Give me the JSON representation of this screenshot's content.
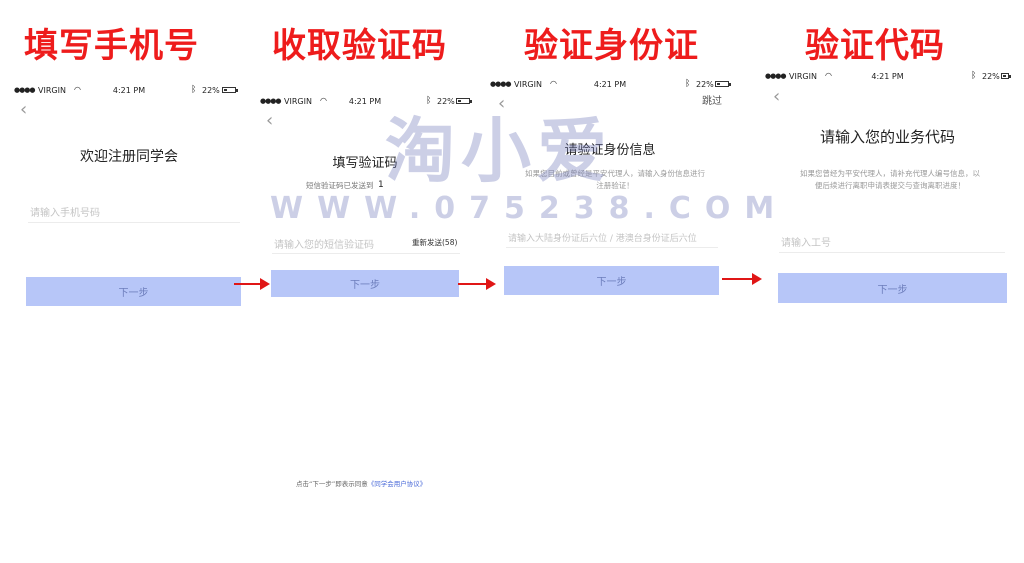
{
  "steps": [
    {
      "title": "填写手机号"
    },
    {
      "title": "收取验证码"
    },
    {
      "title": "验证身份证"
    },
    {
      "title": "验证代码"
    }
  ],
  "status_bar": {
    "signal": "●●●●",
    "carrier": "VIRGIN",
    "wifi": "wifi-icon",
    "time": "4:21 PM",
    "bluetooth": "bluetooth-icon",
    "battery": "22%"
  },
  "screen1": {
    "heading": "欢迎注册同学会",
    "phone_placeholder": "请输入手机号码",
    "next_label": "下一步"
  },
  "screen2": {
    "heading": "填写验证码",
    "sent_note": "短信验证码已发送到",
    "sent_digit": "1",
    "code_placeholder": "请输入您的短信验证码",
    "resend": "重新发送(58)",
    "next_label": "下一步",
    "agreement_prefix": "点击“下一步”即表示同意",
    "agreement_link": "《同学会用户协议》"
  },
  "screen3": {
    "skip": "跳过",
    "heading": "请验证身份信息",
    "desc_line1": "如果您目前或曾经是平安代理人，请输入身份信息进行",
    "desc_line2": "注册验证！",
    "id_placeholder": "请输入大陆身份证后六位 / 港澳台身份证后六位",
    "next_label": "下一步"
  },
  "screen4": {
    "heading": "请输入您的业务代码",
    "desc_line1": "如果您曾经为平安代理人，请补充代理人编号信息，以",
    "desc_line2": "便后续进行离职申请表提交与查询离职进度！",
    "employee_placeholder": "请输入工号",
    "next_label": "下一步"
  },
  "watermark": {
    "logo": "淘小爱",
    "url": "WWW.075238.COM"
  },
  "colors": {
    "step_title": "#ee1c1c",
    "arrow": "#e01616",
    "button_bg": "#b7c6f8",
    "link": "#4a6ad8"
  }
}
